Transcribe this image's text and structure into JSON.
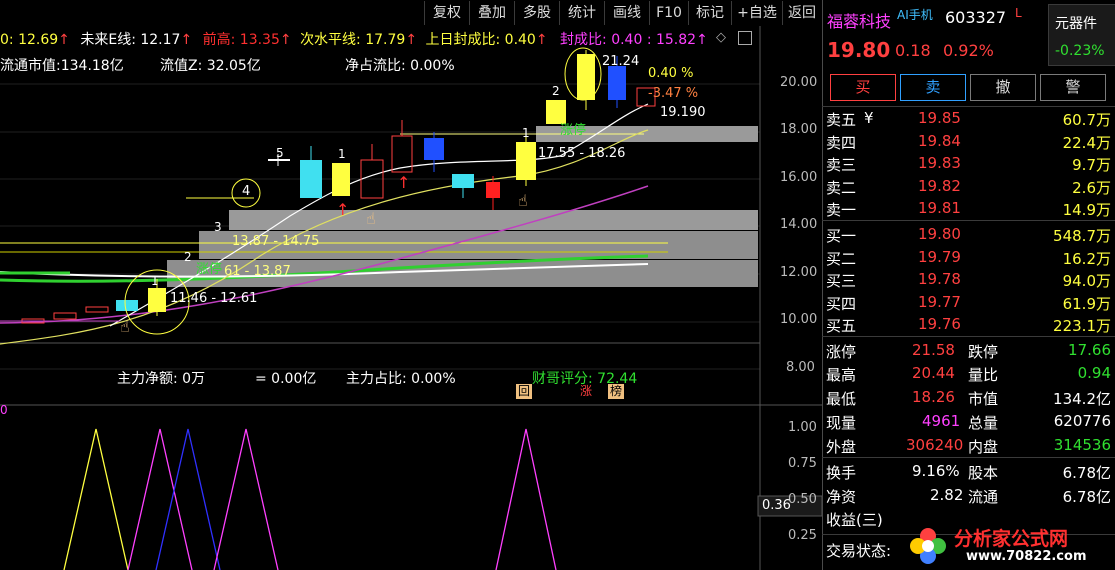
{
  "toolbar": {
    "items": [
      "复权",
      "叠加",
      "多股",
      "统计",
      "画线",
      "F10",
      "标记",
      "+自选",
      "返回"
    ]
  },
  "info_line1": {
    "seg0": "0: 12.69",
    "arrow": "↑",
    "seg1_label": "未来E线: 12.17",
    "seg2_label": "前高: 13.35",
    "seg3_label": "次水平线: 17.79",
    "seg4_label": "上日封成比: 0.40",
    "seg5_label": "封成比: 0.40 : 15.82"
  },
  "info_line2": {
    "market_cap": "流通市值:134.18亿",
    "float_z": "流值Z: 32.05亿",
    "net_ratio": "净占流比: 0.00%"
  },
  "price_axis": {
    "ticks": [
      "20.00",
      "18.00",
      "16.00",
      "14.00",
      "12.00",
      "10.00",
      "8.00"
    ]
  },
  "chart_labels": {
    "top_price": "21.24",
    "pct_up": "0.40 %",
    "pct_down": "-3.47 %",
    "price_right": "19.190",
    "zone_top": "17.55 - 18.26",
    "zone_top_tag": "涨停",
    "zone_mid": "13.87 - 14.75",
    "zone_low": "11.46 - 12.61",
    "zone_low2": "61 - 13.87",
    "zone_low_tag": "涨停",
    "circle_num": "4",
    "n1": "1",
    "n2": "2",
    "n3": "3",
    "n5": "5",
    "n1b": "1",
    "n2b": "2",
    "n1c": "1"
  },
  "bottom_info": {
    "main_net": "主力净额: 0万",
    "eq": "= 0.00亿",
    "main_ratio": "主力占比: 0.00%",
    "score": "财哥评分: 72.44",
    "tags": [
      "回",
      "涨",
      "榜"
    ]
  },
  "indicator_axis": {
    "ticks": [
      "1.00",
      "0.75",
      "0.50",
      "0.25"
    ],
    "current": "0.36",
    "left_label": "0"
  },
  "stock": {
    "name": "福蓉科技",
    "ai_tag": "AI手机",
    "code": "603327",
    "suffix": "L",
    "sector": "元器件",
    "sector_change": "-0.23%",
    "price": "19.80",
    "change": "0.18",
    "change_pct": "0.92%"
  },
  "trade_buttons": [
    "买",
    "卖",
    "撤",
    "警"
  ],
  "order_book": {
    "asks": [
      {
        "label": "卖五",
        "flag": "¥",
        "price": "19.85",
        "vol": "60.7万"
      },
      {
        "label": "卖四",
        "flag": "",
        "price": "19.84",
        "vol": "22.4万"
      },
      {
        "label": "卖三",
        "flag": "",
        "price": "19.83",
        "vol": "9.7万"
      },
      {
        "label": "卖二",
        "flag": "",
        "price": "19.82",
        "vol": "2.6万"
      },
      {
        "label": "卖一",
        "flag": "",
        "price": "19.81",
        "vol": "14.9万"
      }
    ],
    "bids": [
      {
        "label": "买一",
        "price": "19.80",
        "vol": "548.7万"
      },
      {
        "label": "买二",
        "price": "19.79",
        "vol": "16.2万"
      },
      {
        "label": "买三",
        "price": "19.78",
        "vol": "94.0万"
      },
      {
        "label": "买四",
        "price": "19.77",
        "vol": "61.9万"
      },
      {
        "label": "买五",
        "price": "19.76",
        "vol": "223.1万"
      }
    ]
  },
  "stats": {
    "limit_up_label": "涨停",
    "limit_up": "21.58",
    "limit_down_label": "跌停",
    "limit_down": "17.66",
    "high_label": "最高",
    "high": "20.44",
    "vol_ratio_label": "量比",
    "vol_ratio": "0.94",
    "low_label": "最低",
    "low": "18.26",
    "mcap_label": "市值",
    "mcap": "134.2亿",
    "cur_vol_label": "现量",
    "cur_vol": "4961",
    "total_vol_label": "总量",
    "total_vol": "620776",
    "outer_label": "外盘",
    "outer": "306240",
    "inner_label": "内盘",
    "inner": "314536",
    "turnover_label": "换手",
    "turnover": "9.16%",
    "shares_label": "股本",
    "shares": "6.78亿",
    "net_asset_label": "净资",
    "net_asset": "2.82",
    "float_label": "流通",
    "float": "6.78亿",
    "eps_label": "收益(三)",
    "status_label": "交易状态:"
  },
  "watermark": {
    "text": "分析家公式网",
    "url": "www.70822.com"
  }
}
